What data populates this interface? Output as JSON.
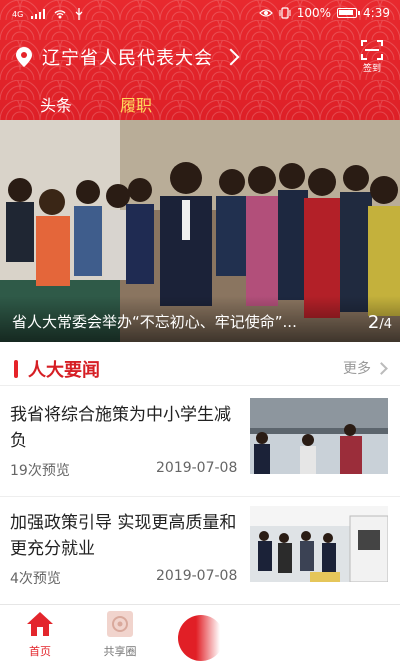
{
  "statusbar": {
    "battery_percent": "100%",
    "time": "4:39",
    "network": "4G"
  },
  "header": {
    "location_title": "辽宁省人民代表大会",
    "sign_label": "签到",
    "tabs": [
      {
        "label": "头条",
        "active": true
      },
      {
        "label": "履职",
        "active": false
      }
    ]
  },
  "banner": {
    "caption": "省人大常委会举办“不忘初心、牢记使命”...",
    "page_current": "2",
    "page_total": "/4"
  },
  "section": {
    "title": "人大要闻",
    "more_label": "更多",
    "items": [
      {
        "title": "我省将综合施策为中小学生减负",
        "views": "19次预览",
        "date": "2019-07-08"
      },
      {
        "title": "加强政策引导 实现更高质量和更充分就业",
        "views": "4次预览",
        "date": "2019-07-08"
      }
    ]
  },
  "bottom_nav": {
    "items": [
      {
        "label": "首页",
        "icon": "home-icon",
        "active": true
      },
      {
        "label": "共享圈",
        "icon": "share-circle-icon",
        "active": false
      }
    ]
  },
  "colors": {
    "brand_red": "#e52329",
    "accent_yellow": "#ffd95a"
  }
}
